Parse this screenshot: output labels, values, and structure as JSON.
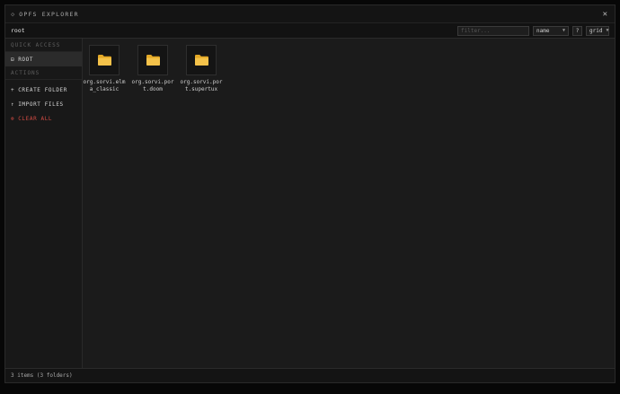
{
  "window": {
    "title_icon": "◇",
    "title": "OPFS EXPLORER",
    "close_label": "✕"
  },
  "toolbar": {
    "path": "root",
    "filter_placeholder": "filter...",
    "sort_value": "name",
    "help_label": "?",
    "view_value": "grid"
  },
  "sidebar": {
    "quick_access_label": "QUICK ACCESS",
    "root": {
      "icon": "⊟",
      "label": "ROOT"
    },
    "actions_label": "ACTIONS",
    "create_folder": {
      "icon": "+",
      "label": "CREATE FOLDER"
    },
    "import_files": {
      "icon": "↑",
      "label": "IMPORT FILES"
    },
    "clear_all": {
      "icon": "⊗",
      "label": "CLEAR ALL"
    }
  },
  "items": [
    {
      "name": "org.sorvi.elma_classic",
      "type": "folder",
      "icon": "folder-icon"
    },
    {
      "name": "org.sorvi.port.doom",
      "type": "folder",
      "icon": "folder-icon"
    },
    {
      "name": "org.sorvi.port.supertux",
      "type": "folder",
      "icon": "folder-icon"
    }
  ],
  "status": {
    "text": "3 items (3 folders)"
  },
  "colors": {
    "folder": "#f0b93a",
    "danger": "#d24b43",
    "accent_bg": "#2b2b2b"
  }
}
